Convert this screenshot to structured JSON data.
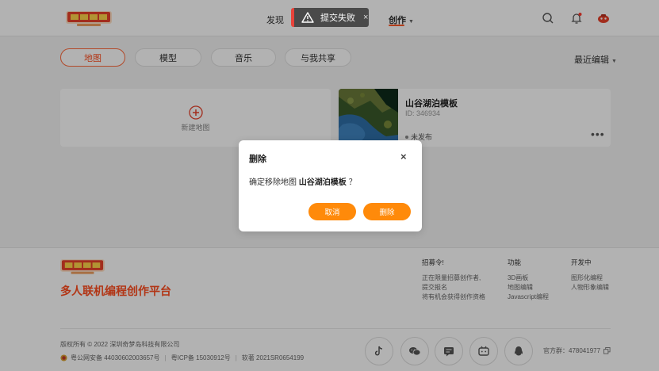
{
  "header": {
    "nav": {
      "discover": "发现",
      "create": "创作"
    },
    "toast": {
      "message": "提交失败",
      "close": "×"
    }
  },
  "tabs": [
    {
      "label": "地图",
      "active": true
    },
    {
      "label": "模型",
      "active": false
    },
    {
      "label": "音乐",
      "active": false
    },
    {
      "label": "与我共享",
      "active": false
    }
  ],
  "sort": {
    "label": "最近编辑"
  },
  "new_card": {
    "label": "新建地图"
  },
  "map_card": {
    "title": "山谷湖泊模板",
    "id": "ID: 346934",
    "status": "未发布",
    "more": "•••"
  },
  "modal": {
    "title": "删除",
    "close": "×",
    "prompt_prefix": "确定移除地图",
    "prompt_target": "山谷湖泊模板",
    "prompt_suffix": "？",
    "cancel": "取消",
    "confirm": "删除"
  },
  "footer": {
    "slogan": "多人联机编程创作平台",
    "recruit": {
      "heading": "招募令!",
      "lines": [
        "正在限量招募创作者,",
        "提交报名",
        "将有机会获得创作资格"
      ]
    },
    "features": {
      "heading": "功能",
      "lines": [
        "3D画板",
        "地图编辑",
        "Javascript编程"
      ]
    },
    "dev": {
      "heading": "开发中",
      "lines": [
        "图形化编程",
        "人物形象编辑"
      ]
    },
    "copyright": "版权所有 © 2022 深圳奇梦岛科技有限公司",
    "beian": {
      "police": "粤公网安备 44030602003657号",
      "icp": "粤ICP备 15030912号",
      "software": "软著 2021SR0654199"
    },
    "qq_group": "官方群：478041977"
  },
  "colors": {
    "accent": "#ff4d1f",
    "button": "#ff8a0a",
    "toast_bg": "#4a4a4a",
    "toast_bar": "#e8433a"
  },
  "icons": [
    "search-icon",
    "bell-icon",
    "avatar-icon",
    "warning-icon",
    "plus-icon",
    "tiktok-icon",
    "wechat-icon",
    "chat-icon",
    "bilibili-icon",
    "qq-icon",
    "copy-icon"
  ]
}
